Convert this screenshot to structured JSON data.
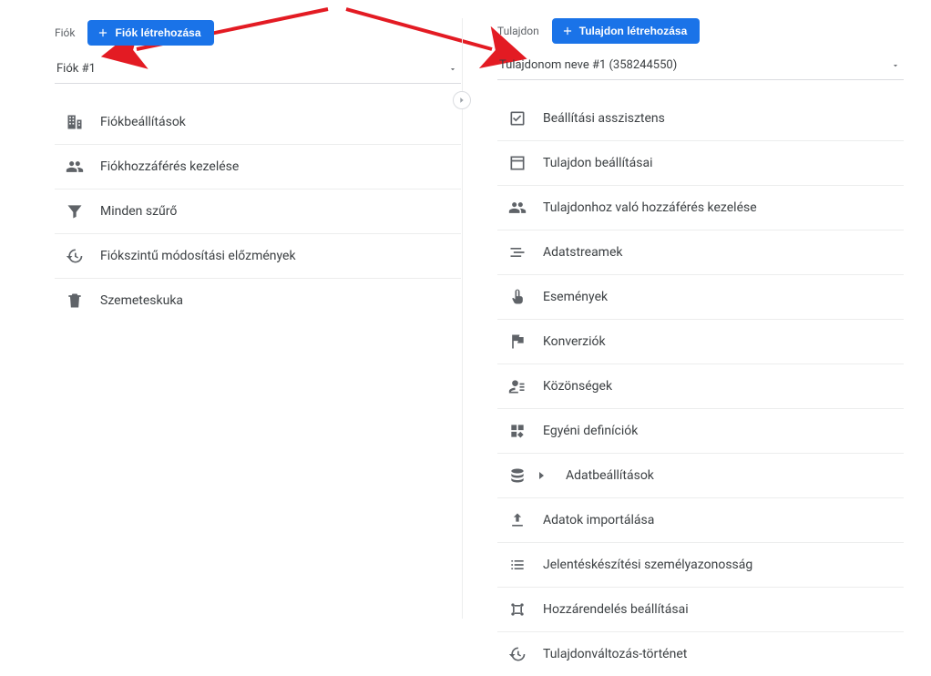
{
  "account": {
    "title": "Fiók",
    "create_label": "Fiók létrehozása",
    "selected": "Fiók #1",
    "items": [
      {
        "label": "Fiókbeállítások"
      },
      {
        "label": "Fiókhozzáférés kezelése"
      },
      {
        "label": "Minden szűrő"
      },
      {
        "label": "Fiókszintű módosítási előzmények"
      },
      {
        "label": "Szemeteskuka"
      }
    ]
  },
  "property": {
    "title": "Tulajdon",
    "create_label": "Tulajdon létrehozása",
    "selected": "Tulajdonom neve #1 (358244550)",
    "items": [
      {
        "label": "Beállítási asszisztens"
      },
      {
        "label": "Tulajdon beállításai"
      },
      {
        "label": "Tulajdonhoz való hozzáférés kezelése"
      },
      {
        "label": "Adatstreamek"
      },
      {
        "label": "Események"
      },
      {
        "label": "Konverziók"
      },
      {
        "label": "Közönségek"
      },
      {
        "label": "Egyéni definíciók"
      },
      {
        "label": "Adatbeállítások",
        "expandable": true
      },
      {
        "label": "Adatok importálása"
      },
      {
        "label": "Jelentéskészítési személyazonosság"
      },
      {
        "label": "Hozzárendelés beállításai"
      },
      {
        "label": "Tulajdonváltozás-történet"
      }
    ]
  }
}
